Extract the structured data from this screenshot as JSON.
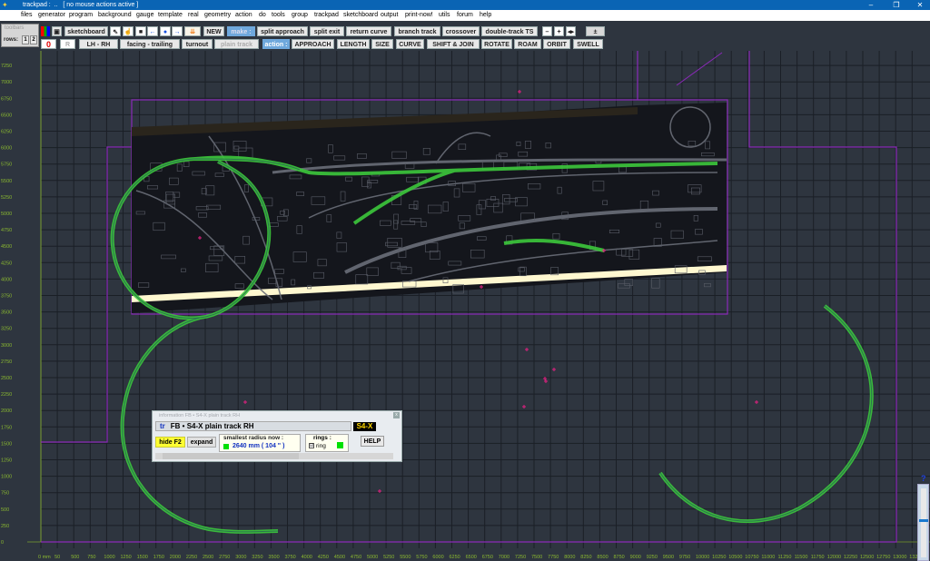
{
  "window": {
    "title": "trackpad :  ..   [ no mouse actions active ]",
    "controls": {
      "minimize": "–",
      "maximize": "❐",
      "close": "✕"
    }
  },
  "menu": [
    "files",
    "generator",
    "program",
    "background",
    "gauge",
    "template",
    "real",
    "geometry",
    "action",
    "do",
    "tools",
    "group",
    "trackpad",
    "sketchboard",
    "output",
    "print-now!",
    "utils",
    "forum",
    "help"
  ],
  "toolbar_box": {
    "label": "toolbars",
    "rows_label": "rows:",
    "row1": "1",
    "row2": "2"
  },
  "toolbar1": {
    "sketchboard": "sketchboard",
    "new": "NEW",
    "make_label": "make :",
    "split_approach": "split approach",
    "split_exit": "split exit",
    "return_curve": "return curve",
    "branch_track": "branch track",
    "crossover": "crossover",
    "double_track": "double-track TS",
    "minus": "–",
    "plus": "+"
  },
  "toolbar2": {
    "zero": "0",
    "r": "R",
    "hand": "LH  -  RH",
    "facing": "facing  -  trailing",
    "turnout": "turnout",
    "plain_track": "plain  track",
    "action_label": "action :",
    "approach": "APPROACH",
    "length": "LENGTH",
    "size": "SIZE",
    "curve": "CURVE",
    "shift_join": "SHIFT & JOIN",
    "rotate": "ROTATE",
    "roam": "ROAM",
    "orbit": "ORBIT",
    "swell": "SWELL"
  },
  "axes": {
    "unit": "mm",
    "y_ticks": [
      "7250",
      "7000",
      "6750",
      "6500",
      "6250",
      "6000",
      "5750",
      "5500",
      "5250",
      "5000",
      "4750",
      "4500",
      "4250",
      "4000",
      "3750",
      "3500",
      "3250",
      "3000",
      "2750",
      "2500",
      "2250",
      "2000",
      "1750",
      "1500",
      "1250",
      "1000",
      "750",
      "500",
      "250",
      "0"
    ],
    "x_ticks": [
      "0",
      "50",
      "500",
      "750",
      "1000",
      "1250",
      "1500",
      "1750",
      "2000",
      "2250",
      "2500",
      "2750",
      "3000",
      "3250",
      "3500",
      "3750",
      "4000",
      "4250",
      "4500",
      "4750",
      "5000",
      "5250",
      "5500",
      "5750",
      "6000",
      "6250",
      "6500",
      "6750",
      "7000",
      "7250",
      "7500",
      "7750",
      "8000",
      "8250",
      "8500",
      "8750",
      "9000",
      "9250",
      "9500",
      "9750",
      "10000",
      "10250",
      "10500",
      "10750",
      "11000",
      "11250",
      "11500",
      "11750",
      "12000",
      "12250",
      "12500",
      "12750",
      "13000",
      "132"
    ]
  },
  "info_panel": {
    "header": "information        FB • S4-X  plain track   RH",
    "tr": "tr",
    "track_desc": "FB • S4-X  plain track   RH",
    "code": "S4-X",
    "hide": "hide  F2",
    "expand": "expand",
    "smallest_radius_label": "smallest  radius  now :",
    "smallest_radius_value": "2640 mm ( 104 \" )",
    "rings_label": "rings :",
    "ring_label": "ring",
    "ring_checked": "☑",
    "help": "HELP"
  },
  "zoom_help": "?",
  "colors": {
    "background": "#2e353f",
    "grid": "#1a1f26",
    "axis": "#8ab830",
    "boundary": "#8a2ab8",
    "track": "#3cc83c",
    "marker": "#e02080",
    "map_bg": "#14161c"
  }
}
